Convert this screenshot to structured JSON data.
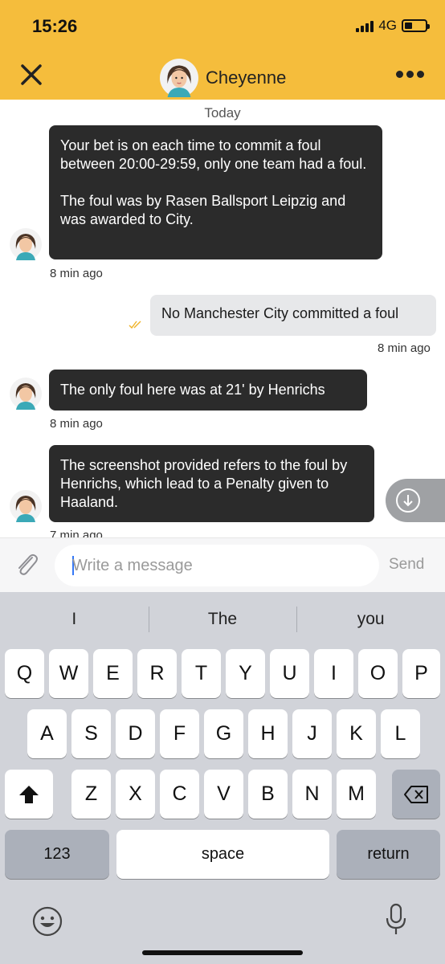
{
  "status_bar": {
    "time": "15:26",
    "network": "4G"
  },
  "header": {
    "contact_name": "Cheyenne",
    "accent_color": "#f5bd3c"
  },
  "chat": {
    "date_separator": "Today",
    "messages": [
      {
        "direction": "in",
        "text": "Your bet is on each time to commit a foul between 20:00-29:59, only one team had a foul.\n\nThe foul was by Rasen Ballsport Leipzig and was awarded to City.",
        "time": "8 min ago"
      },
      {
        "direction": "out",
        "text": "No Manchester City committed a foul",
        "time": "8 min ago",
        "status_icon": "double-check-icon"
      },
      {
        "direction": "in",
        "text": "The only foul here was at 21' by Henrichs",
        "time": "8 min ago"
      },
      {
        "direction": "in",
        "text": "The screenshot provided refers to the foul by Henrichs, which lead to a Penalty given to Haaland.",
        "time": "7 min ago"
      }
    ]
  },
  "composer": {
    "placeholder": "Write a message",
    "send_label": "Send"
  },
  "keyboard": {
    "suggestions": [
      "I",
      "The",
      "you"
    ],
    "row1": [
      "Q",
      "W",
      "E",
      "R",
      "T",
      "Y",
      "U",
      "I",
      "O",
      "P"
    ],
    "row2": [
      "A",
      "S",
      "D",
      "F",
      "G",
      "H",
      "J",
      "K",
      "L"
    ],
    "row3": [
      "Z",
      "X",
      "C",
      "V",
      "B",
      "N",
      "M"
    ],
    "numbers_label": "123",
    "space_label": "space",
    "return_label": "return"
  }
}
